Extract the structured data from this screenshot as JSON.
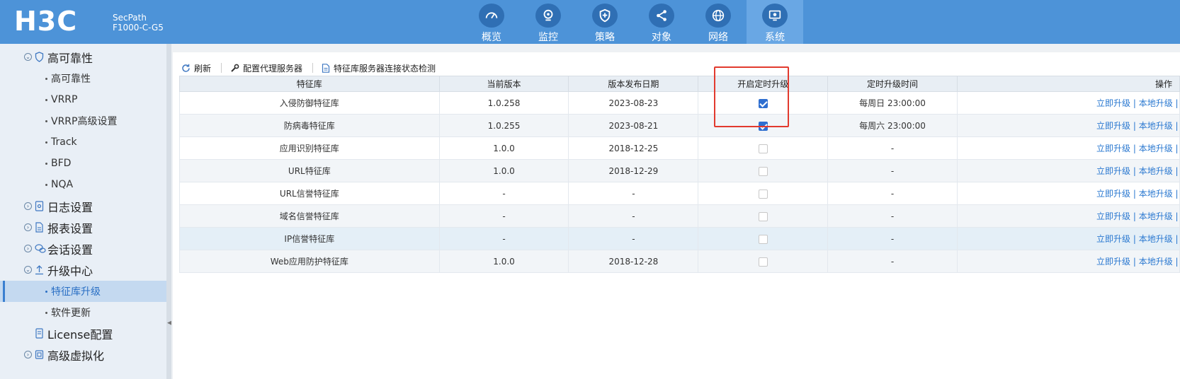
{
  "header": {
    "brand": "H3C",
    "product_line1": "SecPath",
    "product_line2": "F1000-C-G5",
    "nav": [
      {
        "label": "概览",
        "icon": "gauge-icon"
      },
      {
        "label": "监控",
        "icon": "camera-icon"
      },
      {
        "label": "策略",
        "icon": "shield-plus-icon"
      },
      {
        "label": "对象",
        "icon": "share-icon"
      },
      {
        "label": "网络",
        "icon": "globe-icon"
      },
      {
        "label": "系统",
        "icon": "monitor-gear-icon",
        "active": true
      }
    ]
  },
  "sidebar": {
    "items": [
      {
        "label": "高可靠性",
        "level": 1,
        "icon": "shield-icon",
        "expanded": true
      },
      {
        "label": "高可靠性",
        "level": 2
      },
      {
        "label": "VRRP",
        "level": 2
      },
      {
        "label": "VRRP高级设置",
        "level": 2
      },
      {
        "label": "Track",
        "level": 2
      },
      {
        "label": "BFD",
        "level": 2
      },
      {
        "label": "NQA",
        "level": 2
      },
      {
        "label": "日志设置",
        "level": 1,
        "icon": "log-icon"
      },
      {
        "label": "报表设置",
        "level": 1,
        "icon": "report-icon"
      },
      {
        "label": "会话设置",
        "level": 1,
        "icon": "session-icon"
      },
      {
        "label": "升级中心",
        "level": 1,
        "icon": "upload-icon",
        "expanded": true
      },
      {
        "label": "特征库升级",
        "level": 2,
        "active": true
      },
      {
        "label": "软件更新",
        "level": 2
      },
      {
        "label": "License配置",
        "level": 1,
        "icon": "license-icon"
      },
      {
        "label": "高级虚拟化",
        "level": 1,
        "icon": "virtual-icon"
      }
    ]
  },
  "toolbar": {
    "refresh_label": "刷新",
    "proxy_label": "配置代理服务器",
    "check_label": "特征库服务器连接状态检测"
  },
  "table": {
    "columns": [
      "特征库",
      "当前版本",
      "版本发布日期",
      "开启定时升级",
      "定时升级时间",
      "操作"
    ],
    "rows": [
      {
        "name": "入侵防御特征库",
        "version": "1.0.258",
        "date": "2023-08-23",
        "scheduled": true,
        "time": "每周日 23:00:00"
      },
      {
        "name": "防病毒特征库",
        "version": "1.0.255",
        "date": "2023-08-21",
        "scheduled": true,
        "time": "每周六 23:00:00"
      },
      {
        "name": "应用识别特征库",
        "version": "1.0.0",
        "date": "2018-12-25",
        "scheduled": false,
        "time": "-"
      },
      {
        "name": "URL特征库",
        "version": "1.0.0",
        "date": "2018-12-29",
        "scheduled": false,
        "time": "-"
      },
      {
        "name": "URL信誉特征库",
        "version": "-",
        "date": "-",
        "scheduled": false,
        "time": "-"
      },
      {
        "name": "域名信誉特征库",
        "version": "-",
        "date": "-",
        "scheduled": false,
        "time": "-"
      },
      {
        "name": "IP信誉特征库",
        "version": "-",
        "date": "-",
        "scheduled": false,
        "time": "-"
      },
      {
        "name": "Web应用防护特征库",
        "version": "1.0.0",
        "date": "2018-12-28",
        "scheduled": false,
        "time": "-"
      }
    ],
    "op_upgrade_now": "立即升级",
    "op_local_upgrade": "本地升级",
    "op_separator": "|"
  },
  "colors": {
    "header_bg": "#4d93d8",
    "accent": "#2f6fd0",
    "highlight_box": "#e23a2e",
    "link": "#2a78d0"
  }
}
